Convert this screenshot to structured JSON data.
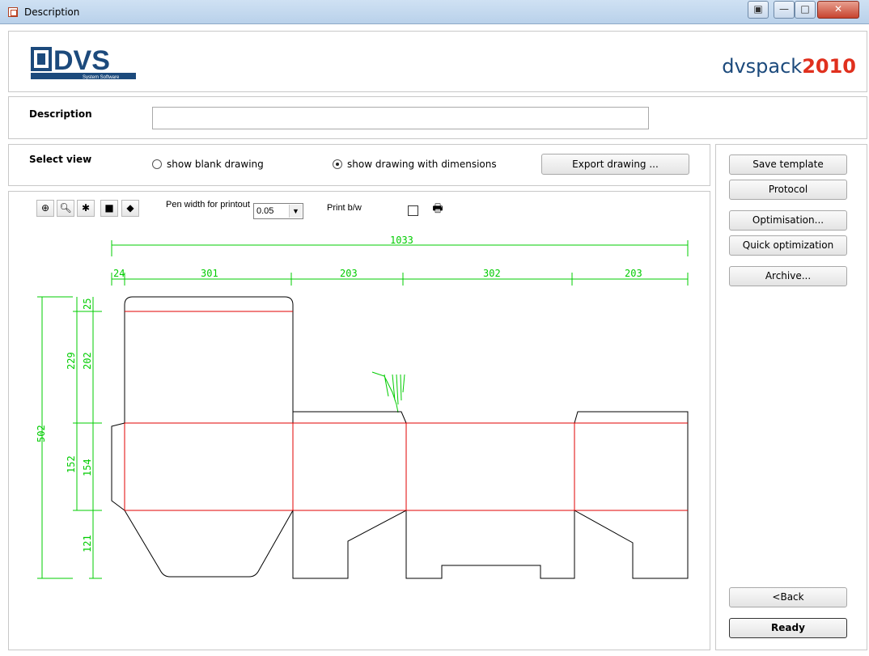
{
  "window": {
    "title": "Description",
    "buttons": [
      "restore-icon",
      "minimize-icon",
      "maximize-icon",
      "close-icon"
    ]
  },
  "header": {
    "logo_text": "DVS",
    "logo_sub": "System Software",
    "product_name_a": "dvspack",
    "product_name_b": "2010"
  },
  "description": {
    "label": "Description",
    "value": ""
  },
  "view": {
    "label": "Select view",
    "options": [
      {
        "label": "show blank drawing",
        "selected": false
      },
      {
        "label": "show drawing with dimensions",
        "selected": true
      }
    ],
    "export_label": "Export drawing ..."
  },
  "toolbar": {
    "icons": [
      "zoom-in-icon",
      "zoom-out-icon",
      "zoom-fit-icon",
      "color-icon",
      "layers-icon"
    ],
    "pen_width_label": "Pen width for printout",
    "pen_width_value": "0.05",
    "print_bw_label": "Print b/w",
    "print_bw_checked": false
  },
  "sidebar": {
    "save_template": "Save template",
    "protocol": "Protocol",
    "optimisation": "Optimisation...",
    "quick_optimization": "Quick optimization",
    "archive": "Archive...",
    "back": "<Back",
    "ready": "Ready"
  },
  "drawing": {
    "total_width": "1033",
    "horizontal_dims": [
      "24",
      "301",
      "203",
      "302",
      "203"
    ],
    "vertical_dims": [
      "502",
      "229",
      "25",
      "202",
      "152",
      "154",
      "121"
    ],
    "colors": {
      "dimension": "#00cc00",
      "fold": "#e00000",
      "cut": "#000000"
    }
  }
}
